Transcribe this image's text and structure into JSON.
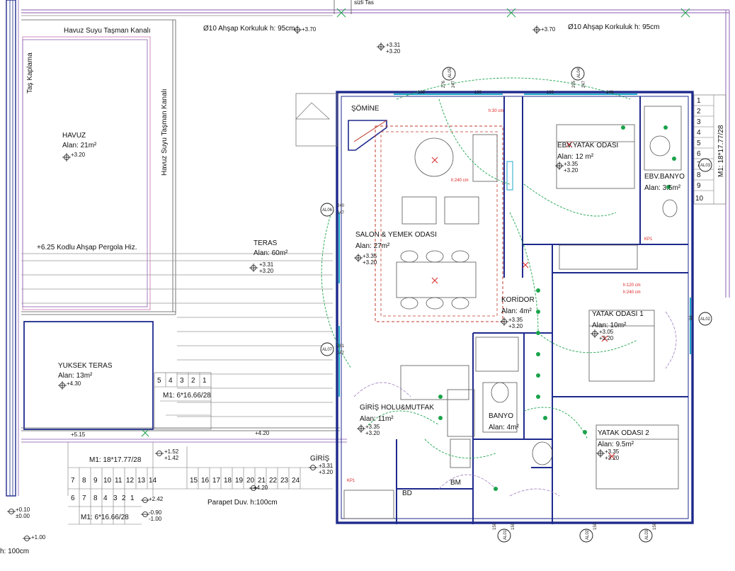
{
  "colors": {
    "wall": "#1e2a8c",
    "purple": "#a07cc0",
    "pink": "#d9a0c8",
    "green": "#19a34a",
    "red": "#d62828",
    "dashed_red": "#c0392b",
    "orange": "#e08a2e",
    "cyan": "#1fa9c9",
    "grey": "#777777"
  },
  "header": {
    "top_fragment": "sizli Tas",
    "railing_left": "Ø10 Ahşap Korkuluk h: 95cm",
    "railing_right": "Ø10 Ahşap Korkuluk h: 95cm",
    "level_370_a": "+3.70",
    "level_370_b": "+3.70",
    "level_331_top": "+3.31",
    "level_320_top": "+3.20"
  },
  "pool": {
    "channel_top": "Havuz Suyu Taşman Kanalı",
    "channel_side": "Havuz Suyu Taşman Kanalı",
    "stone": "Taş Kaplama",
    "name": "HAVUZ",
    "area": "Alan: 21m²",
    "level": "+3.20"
  },
  "terrace": {
    "pergola": "+6.25 Kodlu Ahşap Pergola Hiz.",
    "name": "TERAS",
    "area": "Alan: 60m²",
    "level_a": "+3.31",
    "level_b": "+3.20"
  },
  "high_terrace": {
    "name": "YUKSEK TERAS",
    "area": "Alan: 13m²",
    "level": "+4.30",
    "stair_nums": [
      "5",
      "4",
      "3",
      "2",
      "1"
    ],
    "stair_label": "M1: 6*16.66/28"
  },
  "lower": {
    "level_515": "+5.15",
    "level_420_a": "+4.20",
    "level_420_b": "+4.20",
    "stair_main_label": "M1: 18*17.77/28",
    "level_152": "+1.52",
    "level_142": "+1.42",
    "giris": "GİRİŞ",
    "giris_a": "+3.31",
    "giris_b": "+3.20",
    "stair_row": [
      "15",
      "16",
      "17",
      "18",
      "19",
      "20",
      "21",
      "22",
      "23",
      "24"
    ],
    "stair_row2": [
      "7",
      "8",
      "9",
      "10",
      "11",
      "12",
      "13",
      "14"
    ],
    "stair_row3": [
      "6",
      "7",
      "8",
      "4",
      "3",
      "2",
      "1"
    ],
    "stair_small_label": "M1: 6*16.66/28",
    "level_242": "+2.42",
    "level_m090": "-0.90",
    "level_m100": "-1.00",
    "level_010": "+0.10",
    "level_000": "±0.00",
    "level_100": "+1.00",
    "parapet": "Parapet Duv. h:100cm",
    "parapet_left": "h: 100cm"
  },
  "rooms": {
    "somine": "ŞÖMİNE",
    "salon": "SALON & YEMEK ODASI",
    "salon_area": "Alan: 27m²",
    "salon_a": "+3.35",
    "salon_b": "+3.20",
    "ebv_yatak": "EBV.YATAK ODASI",
    "ebv_yatak_area": "Alan: 12 m²",
    "ebv_yatak_a": "+3.35",
    "ebv_yatak_b": "+3.20",
    "ebv_banyo": "EBV.BANYO",
    "ebv_banyo_area": "Alan: 3.5m²",
    "koridor": "KORİDOR",
    "koridor_area": "Alan: 4m²",
    "koridor_a": "+3.35",
    "koridor_b": "+3.20",
    "yatak1": "YATAK ODASI 1",
    "yatak1_area": "Alan: 10m²",
    "yatak1_a": "+3.05",
    "yatak1_b": "+3.20",
    "giris_holu": "GİRİŞ HOLU&MUTFAK",
    "giris_holu_area": "Alan: 11m²",
    "giris_holu_a": "+3.35",
    "giris_holu_b": "+3.20",
    "banyo": "BANYO",
    "banyo_area": "Alan: 4m²",
    "yatak2": "YATAK ODASI 2",
    "yatak2_area": "Alan: 9.5m²",
    "yatak2_a": "+3.35",
    "yatak2_b": "+3.20",
    "bd": "BD",
    "bm": "BM",
    "kp1": "KP1",
    "kp1b": "KP1"
  },
  "right_stair": {
    "nums": [
      "1",
      "2",
      "3",
      "4",
      "5",
      "6",
      "7",
      "8",
      "9",
      "10"
    ],
    "label": "M1: 18*17.77/28"
  },
  "tags": {
    "al01": "AL01",
    "al02": "AL02",
    "al03": "AL03",
    "al04": "AL04",
    "al05": "AL05",
    "al06": "AL06",
    "al07": "AL07",
    "al02b": "AL02",
    "al03b": "AL03"
  },
  "dims": {
    "d138a": "138",
    "d138b": "138",
    "d138c": "138",
    "d148": "148",
    "d276": "276",
    "d247a": "247",
    "d295": "295",
    "d247b": "247",
    "d240": "240",
    "d247c": "247",
    "d281": "281",
    "d247d": "247",
    "d98": "98",
    "d150": "150",
    "d150b": "150",
    "d150c": "150",
    "d150d": "150"
  },
  "notes": {
    "h240": "h:240 cm",
    "h30": "h:30 cm",
    "h120": "h:120 cm",
    "h240b": "h:240 cm"
  }
}
